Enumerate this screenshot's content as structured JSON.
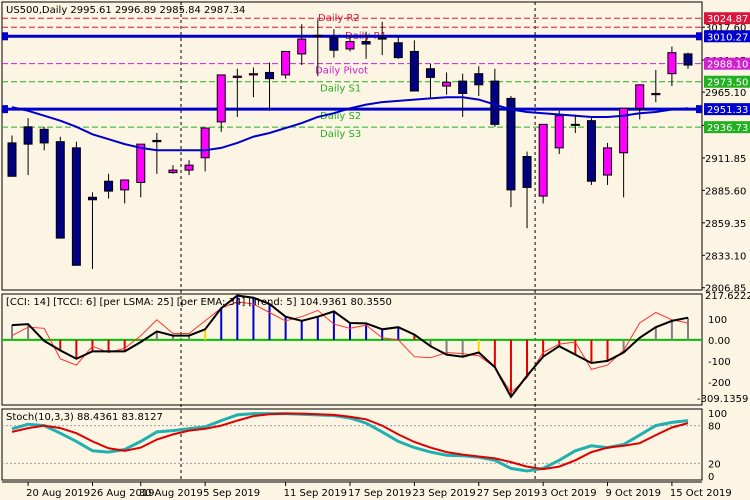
{
  "header": {
    "title": "US500,Daily  2995.61 2996.89 2985.84 2987.34"
  },
  "colors": {
    "background": "#fdf5e3",
    "bull": "#ff00ff",
    "bear": "#000080",
    "ma": "#0000cd",
    "pivot_r2": "#dc143c",
    "pivot": "#d020d0",
    "pivot_s": "#20b020",
    "hline": "#0000cd",
    "cci_hist_up": "#0000cd",
    "cci_hist_down": "#dc0000",
    "cci_hist_neutral": "#808080",
    "cci_hist_yellow": "#ffd700",
    "cci_line": "#000000",
    "tcci_line": "#ff3030",
    "zero_line": "#00c000",
    "stoch_main": "#20b0b0",
    "stoch_signal": "#dc0000",
    "grid": "#c8b8a0"
  },
  "chart_data": [
    {
      "type": "candlestick",
      "symbol": "US500",
      "timeframe": "Daily",
      "dates": [
        "2019-08-19",
        "2019-08-20",
        "2019-08-21",
        "2019-08-22",
        "2019-08-23",
        "2019-08-26",
        "2019-08-27",
        "2019-08-28",
        "2019-08-29",
        "2019-08-30",
        "2019-09-02",
        "2019-09-03",
        "2019-09-04",
        "2019-09-05",
        "2019-09-06",
        "2019-09-09",
        "2019-09-10",
        "2019-09-11",
        "2019-09-12",
        "2019-09-13",
        "2019-09-16",
        "2019-09-17",
        "2019-09-18",
        "2019-09-19",
        "2019-09-20",
        "2019-09-23",
        "2019-09-24",
        "2019-09-25",
        "2019-09-26",
        "2019-09-27",
        "2019-09-30",
        "2019-10-01",
        "2019-10-02",
        "2019-10-03",
        "2019-10-04",
        "2019-10-07",
        "2019-10-08",
        "2019-10-09",
        "2019-10-10",
        "2019-10-11",
        "2019-10-14",
        "2019-10-15",
        "2019-10-16"
      ],
      "open": [
        2924,
        2937,
        2935,
        2925,
        2920,
        2880,
        2893,
        2886,
        2892,
        2926,
        2900,
        2902,
        2912,
        2941,
        2977,
        2979,
        2981,
        2979,
        2996,
        3011,
        3009,
        3000,
        3006,
        3009,
        3005,
        2998,
        2984,
        2970,
        2974,
        2980,
        2974,
        2960,
        2913,
        2881,
        2920,
        2939,
        2942,
        2898,
        2916,
        2952,
        2963,
        2980,
        2996
      ],
      "high": [
        2930,
        2944,
        2937,
        2929,
        2925,
        2884,
        2899,
        2894,
        2904,
        2932,
        2906,
        2910,
        2922,
        2950,
        2984,
        2985,
        2989,
        2997,
        3020,
        3024,
        3016,
        3010,
        3014,
        3022,
        3010,
        3007,
        2988,
        2981,
        2980,
        2986,
        2984,
        2962,
        2917,
        2920,
        2950,
        2947,
        2945,
        2924,
        2918,
        2971,
        2983,
        3002,
        2997
      ],
      "low": [
        2910,
        2898,
        2918,
        2871,
        2834,
        2822,
        2879,
        2875,
        2880,
        2899,
        2899,
        2898,
        2901,
        2933,
        2945,
        2961,
        2950,
        2976,
        2987,
        2978,
        2993,
        2998,
        2992,
        2995,
        2992,
        2966,
        2960,
        2963,
        2945,
        2962,
        2937,
        2872,
        2855,
        2875,
        2915,
        2932,
        2890,
        2890,
        2880,
        2943,
        2957,
        2970,
        2984
      ],
      "close": [
        2897,
        2923,
        2924,
        2847,
        2825,
        2878,
        2885,
        2894,
        2923,
        2925,
        2902,
        2906,
        2936,
        2979,
        2978,
        2980,
        2976,
        2998,
        3008,
        3011,
        2999,
        3006,
        3004,
        3008,
        2993,
        2966,
        2977,
        2973,
        2964,
        2971,
        2939,
        2886,
        2888,
        2939,
        2946,
        2939,
        2893,
        2920,
        2952,
        2971,
        2964,
        2997,
        2987
      ],
      "ma": [
        2953,
        2950,
        2946,
        2942,
        2937,
        2931,
        2927,
        2923,
        2920,
        2918,
        2918,
        2918,
        2918,
        2920,
        2924,
        2929,
        2932,
        2936,
        2940,
        2945,
        2948,
        2952,
        2955,
        2957,
        2958,
        2959,
        2960,
        2961,
        2961,
        2959,
        2955,
        2951,
        2949,
        2948,
        2947,
        2946,
        2945,
        2945,
        2946,
        2948,
        2949,
        2951,
        2952
      ],
      "pivot_levels": [
        {
          "label": "Daily R2",
          "value": 3024.87
        },
        {
          "label": "Daily R1",
          "value": 3017.6
        },
        {
          "label": "Daily Pivot",
          "value": 2988.1
        },
        {
          "label": "Daily S1",
          "value": 2973.5
        },
        {
          "label": "Daily S2",
          "value": 2951.33
        },
        {
          "label": "Daily S3",
          "value": 2936.73
        }
      ],
      "marked_prices": [
        3024.87,
        3017.6,
        3010.27,
        2988.1,
        2973.5,
        2951.33,
        2936.73
      ],
      "horizontal_lines": [
        3010.27,
        2951.33
      ],
      "y_ticks": [
        "3017.60",
        "2991.05",
        "2965.10",
        "2938.15",
        "2911.85",
        "2885.60",
        "2859.35",
        "2833.10",
        "2806.85"
      ],
      "ylim": [
        2805,
        3038
      ]
    },
    {
      "type": "histogram",
      "title": "[CCI: 14] [TCCI: 6] [per LSMA: 25] [per EMA: 34] [Trend: 5]  104.9361 80.3550",
      "cci": [
        70,
        75,
        -5,
        -50,
        -90,
        -55,
        -55,
        -55,
        -10,
        40,
        20,
        20,
        50,
        150,
        210,
        200,
        170,
        110,
        90,
        110,
        135,
        80,
        78,
        50,
        60,
        25,
        -30,
        -70,
        -80,
        -60,
        -130,
        -270,
        -170,
        -80,
        -30,
        -70,
        -110,
        -100,
        -60,
        10,
        60,
        90,
        105
      ],
      "tcci": [
        20,
        60,
        55,
        -90,
        -120,
        -30,
        -60,
        -40,
        20,
        95,
        30,
        30,
        90,
        150,
        180,
        170,
        130,
        90,
        110,
        140,
        75,
        55,
        70,
        10,
        0,
        -80,
        -85,
        -60,
        -65,
        -75,
        -130,
        -250,
        -180,
        -60,
        -20,
        -10,
        -140,
        -120,
        -50,
        80,
        130,
        95,
        80
      ],
      "hist_color": [
        "g",
        "g",
        "r",
        "r",
        "r",
        "r",
        "r",
        "r",
        "g",
        "g",
        "g",
        "g",
        "y",
        "b",
        "b",
        "b",
        "b",
        "b",
        "b",
        "b",
        "b",
        "b",
        "b",
        "b",
        "b",
        "r",
        "g",
        "g",
        "g",
        "y",
        "r",
        "r",
        "r",
        "r",
        "r",
        "r",
        "r",
        "r",
        "g",
        "g",
        "g",
        "g",
        "g"
      ],
      "y_ticks": [
        "100",
        "0.00",
        "-100",
        "-200"
      ],
      "top_label": "217.6222",
      "bottom_label": "-309.1359",
      "ylim": [
        -309.1359,
        217.6222
      ]
    },
    {
      "type": "line",
      "title": "Stoch(10,3,3) 88.4361 83.8127",
      "main": [
        75,
        82,
        80,
        68,
        55,
        40,
        38,
        42,
        55,
        70,
        72,
        75,
        78,
        88,
        97,
        99,
        99,
        99,
        98,
        97,
        96,
        92,
        84,
        70,
        55,
        45,
        38,
        33,
        32,
        30,
        25,
        12,
        8,
        12,
        25,
        40,
        48,
        45,
        50,
        65,
        80,
        85,
        88
      ],
      "signal": [
        70,
        76,
        80,
        76,
        68,
        55,
        44,
        40,
        45,
        58,
        66,
        72,
        75,
        80,
        88,
        95,
        98,
        99,
        99,
        98,
        97,
        94,
        90,
        80,
        66,
        54,
        45,
        38,
        34,
        31,
        28,
        22,
        15,
        11,
        15,
        25,
        38,
        45,
        48,
        52,
        65,
        77,
        84
      ],
      "y_ticks": [
        "100",
        "80",
        "20",
        "0"
      ],
      "levels": [
        80,
        20
      ],
      "ylim": [
        0,
        100
      ]
    }
  ],
  "x_axis": {
    "tick_labels": [
      "20 Aug 2019",
      "26 Aug 2019",
      "30 Aug 2019",
      "5 Sep 2019",
      "11 Sep 2019",
      "17 Sep 2019",
      "23 Sep 2019",
      "27 Sep 2019",
      "3 Oct 2019",
      "9 Oct 2019",
      "15 Oct 2019"
    ],
    "tick_bars": [
      1,
      5,
      8,
      12,
      17,
      21,
      25,
      29,
      33,
      37,
      41
    ],
    "period_separators": [
      10,
      32
    ]
  }
}
